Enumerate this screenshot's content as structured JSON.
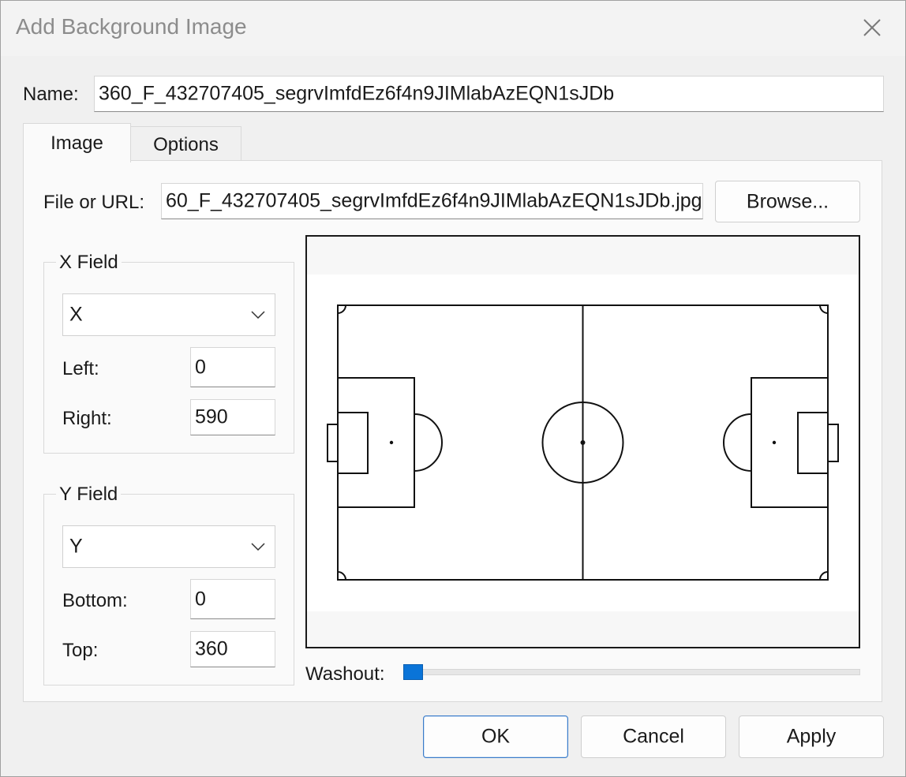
{
  "window": {
    "title": "Add Background Image",
    "close_icon": "close-icon"
  },
  "name_row": {
    "label": "Name:",
    "value": "360_F_432707405_segrvImfdEz6f4n9JIMlabAzEQN1sJDb"
  },
  "tabs": [
    {
      "label": "Image",
      "selected": true
    },
    {
      "label": "Options",
      "selected": false
    }
  ],
  "file_row": {
    "label": "File or URL:",
    "value": "60_F_432707405_segrvImfdEz6f4n9JIMlabAzEQN1sJDb.jpg",
    "browse_label": "Browse..."
  },
  "x_field": {
    "title": "X Field",
    "selected": "X",
    "left_label": "Left:",
    "left_value": "0",
    "right_label": "Right:",
    "right_value": "590"
  },
  "y_field": {
    "title": "Y Field",
    "selected": "Y",
    "bottom_label": "Bottom:",
    "bottom_value": "0",
    "top_label": "Top:",
    "top_value": "360"
  },
  "washout": {
    "label": "Washout:",
    "value_fraction": 0.0,
    "accent": "#0a74d8"
  },
  "buttons": {
    "ok": "OK",
    "cancel": "Cancel",
    "apply": "Apply"
  }
}
